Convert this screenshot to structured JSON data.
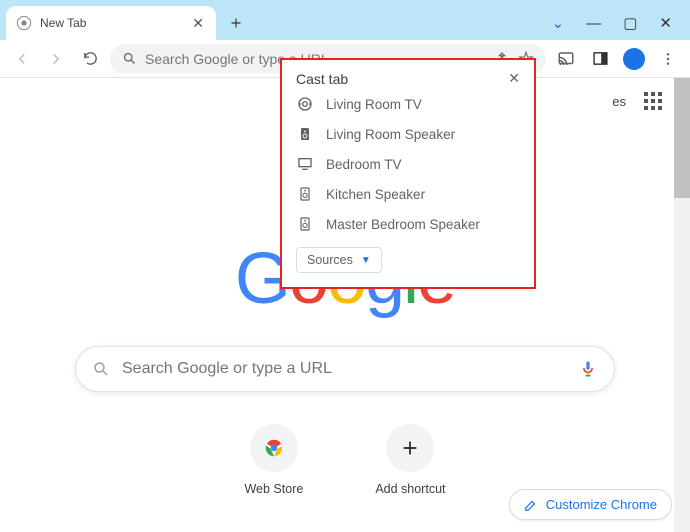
{
  "tab": {
    "title": "New Tab"
  },
  "omnibox": {
    "placeholder": "Search Google or type a URL"
  },
  "topright": {
    "images_link": "es"
  },
  "searchbox": {
    "placeholder": "Search Google or type a URL"
  },
  "shortcuts": {
    "webstore": "Web Store",
    "add": "Add shortcut"
  },
  "customize_label": "Customize Chrome",
  "cast": {
    "title": "Cast tab",
    "devices": [
      {
        "label": "Living Room TV",
        "icon": "chromecast"
      },
      {
        "label": "Living Room Speaker",
        "icon": "speaker"
      },
      {
        "label": "Bedroom TV",
        "icon": "tv"
      },
      {
        "label": "Kitchen Speaker",
        "icon": "speaker-box"
      },
      {
        "label": "Master Bedroom Speaker",
        "icon": "speaker-box"
      }
    ],
    "sources_label": "Sources"
  }
}
